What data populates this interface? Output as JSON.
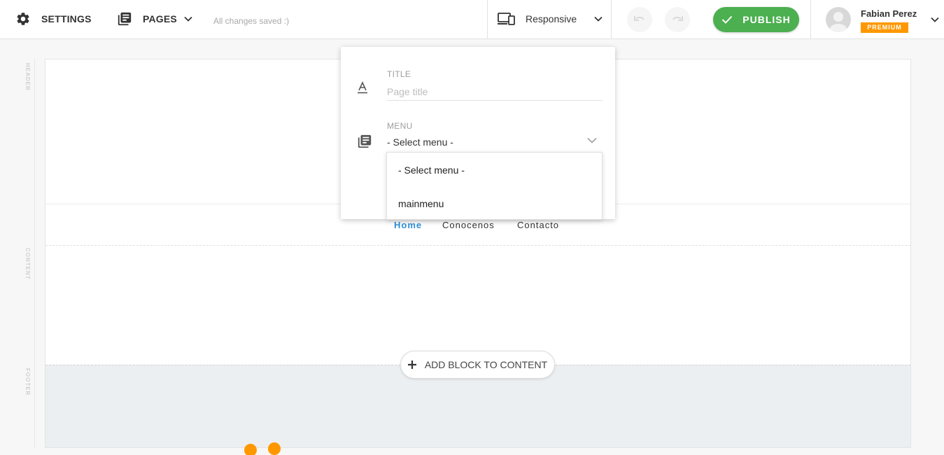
{
  "toolbar": {
    "settings_label": "SETTINGS",
    "pages_label": "PAGES",
    "save_status": "All changes saved :)",
    "responsive_label": "Responsive",
    "publish_label": "PUBLISH",
    "user": {
      "name": "Fabian Perez",
      "plan_badge": "PREMIUM"
    }
  },
  "canvas": {
    "section_labels": {
      "header": "HEADER",
      "content": "CONTENT",
      "footer": "FOOTER"
    },
    "nav_links": [
      {
        "label": "Home",
        "active": true
      },
      {
        "label": "Conocenos",
        "active": false
      },
      {
        "label": "Contacto",
        "active": false
      }
    ],
    "add_block_label": "ADD BLOCK TO CONTENT"
  },
  "popup": {
    "title_field": {
      "label": "TITLE",
      "value": "",
      "placeholder": "Page title"
    },
    "menu_field": {
      "label": "MENU",
      "selected": "- Select menu -",
      "options": [
        "- Select menu -",
        "mainmenu"
      ]
    }
  },
  "colors": {
    "accent_green": "#4caf50",
    "premium_orange": "#ff9800",
    "nav_active_blue": "#2f8fd8",
    "footer_bg": "#eceff1"
  },
  "icons": {
    "settings": "gear-icon",
    "pages": "pages-icon",
    "responsive": "devices-icon",
    "undo": "undo-icon",
    "redo": "redo-icon",
    "publish": "check-icon",
    "title": "text-format-icon",
    "menu": "menu-list-icon",
    "add": "plus-icon"
  }
}
